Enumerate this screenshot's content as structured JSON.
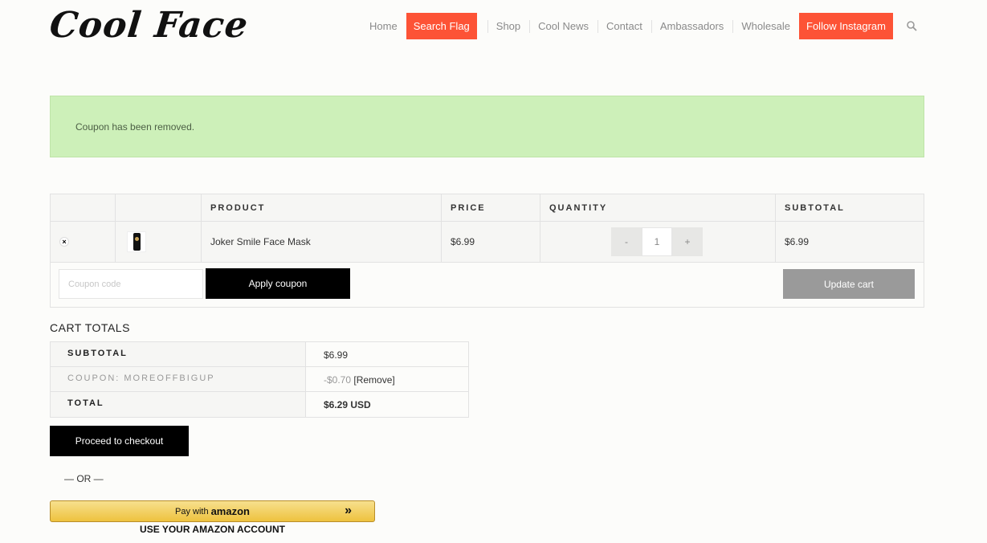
{
  "brand": {
    "logo_text": "Cool Face"
  },
  "nav": {
    "items": [
      {
        "label": "Home"
      },
      {
        "label": "Search Flag"
      },
      {
        "label": "Shop"
      },
      {
        "label": "Cool News"
      },
      {
        "label": "Contact"
      },
      {
        "label": "Ambassadors"
      },
      {
        "label": "Wholesale"
      },
      {
        "label": "Follow Instagram"
      }
    ],
    "search_icon": "search-icon",
    "accent_color": "#fd5336"
  },
  "notice": {
    "message": "Coupon has been removed.",
    "color": "#cdf0b9"
  },
  "cart": {
    "headers": {
      "product": "PRODUCT",
      "price": "PRICE",
      "quantity": "QUANTITY",
      "subtotal": "SUBTOTAL"
    },
    "items": [
      {
        "remove_icon": "remove-x-icon",
        "thumbnail": "product-thumbnail",
        "product": "Joker Smile Face Mask",
        "price": "$6.99",
        "qty_minus": "-",
        "quantity": "1",
        "qty_plus": "+",
        "subtotal": "$6.99"
      }
    ],
    "coupon_placeholder": "Coupon code",
    "apply_label": "Apply coupon",
    "update_label": "Update cart"
  },
  "totals": {
    "title": "CART TOTALS",
    "subtotal_label": "SUBTOTAL",
    "subtotal_value": "$6.99",
    "coupon_label": "COUPON: MOREOFFBIGUP",
    "coupon_value": "-$0.70",
    "coupon_remove": "[Remove]",
    "total_label": "TOTAL",
    "total_value": "$6.29 USD"
  },
  "checkout": {
    "proceed_label": "Proceed to checkout",
    "or_text": "— OR —",
    "amazon_prefix": "Pay with",
    "amazon_word": "amazon",
    "amazon_chevron": "»",
    "amazon_note": "USE YOUR AMAZON ACCOUNT"
  }
}
